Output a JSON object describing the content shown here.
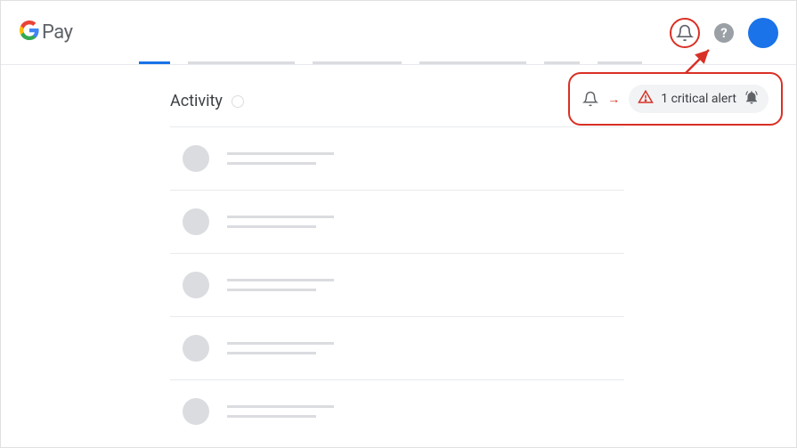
{
  "header": {
    "logo_text": "Pay"
  },
  "section": {
    "title": "Activity"
  },
  "callout": {
    "alert_label": "1 critical alert"
  },
  "colors": {
    "accent": "#1a73e8",
    "danger": "#d93025"
  }
}
